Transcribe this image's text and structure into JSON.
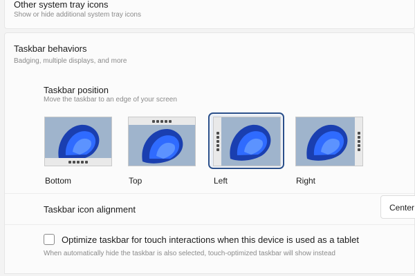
{
  "tray": {
    "title": "Other system tray icons",
    "subtitle": "Show or hide additional system tray icons"
  },
  "behaviors": {
    "title": "Taskbar behaviors",
    "subtitle": "Badging, multiple displays, and more"
  },
  "position": {
    "title": "Taskbar position",
    "subtitle": "Move the taskbar to an edge of your screen",
    "options": [
      {
        "label": "Bottom",
        "edge": "bottom"
      },
      {
        "label": "Top",
        "edge": "top"
      },
      {
        "label": "Left",
        "edge": "left"
      },
      {
        "label": "Right",
        "edge": "right"
      }
    ],
    "selected": "Left"
  },
  "alignment": {
    "label": "Taskbar icon alignment",
    "value": "Center"
  },
  "touch": {
    "label": "Optimize taskbar for touch interactions when this device is used as a tablet",
    "subtitle": "When automatically hide the taskbar is also selected, touch-optimized taskbar will show instead",
    "checked": false
  },
  "colors": {
    "accent": "#2a4f8a",
    "wallpaper_blue": "#1d4fd0",
    "wallpaper_bg": "#9fb4cc"
  },
  "icons": [
    "wallpaper-bloom-icon",
    "checkbox-icon"
  ]
}
